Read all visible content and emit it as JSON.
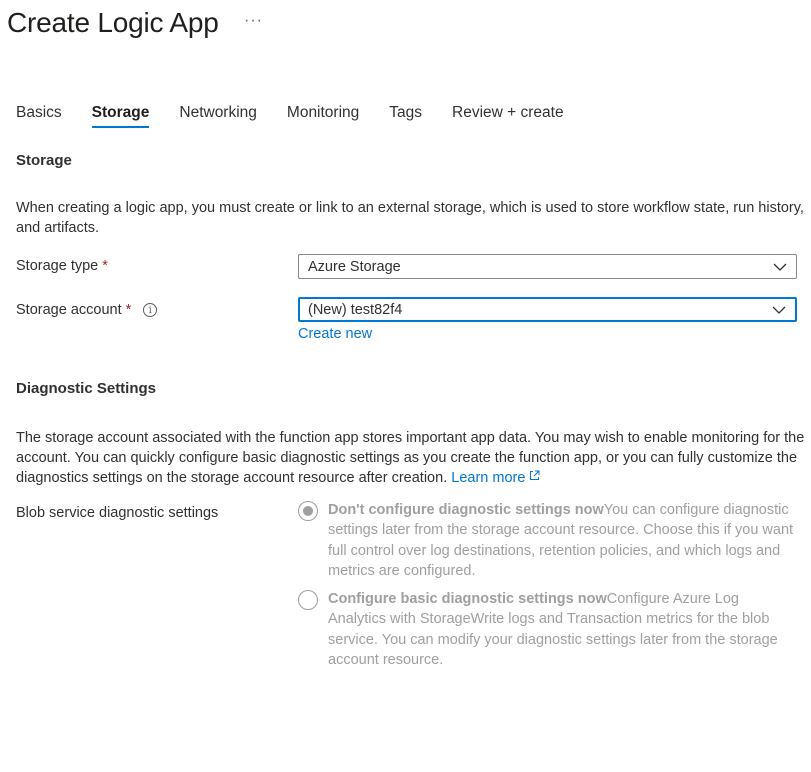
{
  "header": {
    "title": "Create Logic App",
    "more_label": "···"
  },
  "tabs": [
    {
      "label": "Basics",
      "active": false
    },
    {
      "label": "Storage",
      "active": true
    },
    {
      "label": "Networking",
      "active": false
    },
    {
      "label": "Monitoring",
      "active": false
    },
    {
      "label": "Tags",
      "active": false
    },
    {
      "label": "Review + create",
      "active": false
    }
  ],
  "storage": {
    "section_title": "Storage",
    "description": "When creating a logic app, you must create or link to an external storage, which is used to store workflow state, run history, and artifacts.",
    "storage_type": {
      "label": "Storage type",
      "required_mark": "*",
      "value": "Azure Storage"
    },
    "storage_account": {
      "label": "Storage account",
      "required_mark": "*",
      "info_icon": "info-icon",
      "info_glyph": "i",
      "value": "(New) test82f4",
      "create_new": "Create new"
    }
  },
  "diagnostics": {
    "section_title": "Diagnostic Settings",
    "description": "The storage account associated with the function app stores important app data. You may wish to enable monitoring for the account. You can quickly configure basic diagnostic settings as you create the function app, or you can fully customize the diagnostics settings on the storage account resource after creation.",
    "learn_more": "Learn more",
    "learn_more_icon": "external-link-icon",
    "blob_label": "Blob service diagnostic settings",
    "options": [
      {
        "title": "Don't configure diagnostic settings now",
        "text": "You can configure diagnostic settings later from the storage account resource. Choose this if you want full control over log destinations, retention policies, and which logs and metrics are configured.",
        "checked": true
      },
      {
        "title": "Configure basic diagnostic settings now",
        "text": "Configure Azure Log Analytics with StorageWrite logs and Transaction metrics for the blob service. You can modify your diagnostic settings later from the storage account resource.",
        "checked": false
      }
    ]
  },
  "colors": {
    "accent": "#0078d4",
    "required": "#a4262c",
    "disabled_text": "#a19f9d"
  }
}
